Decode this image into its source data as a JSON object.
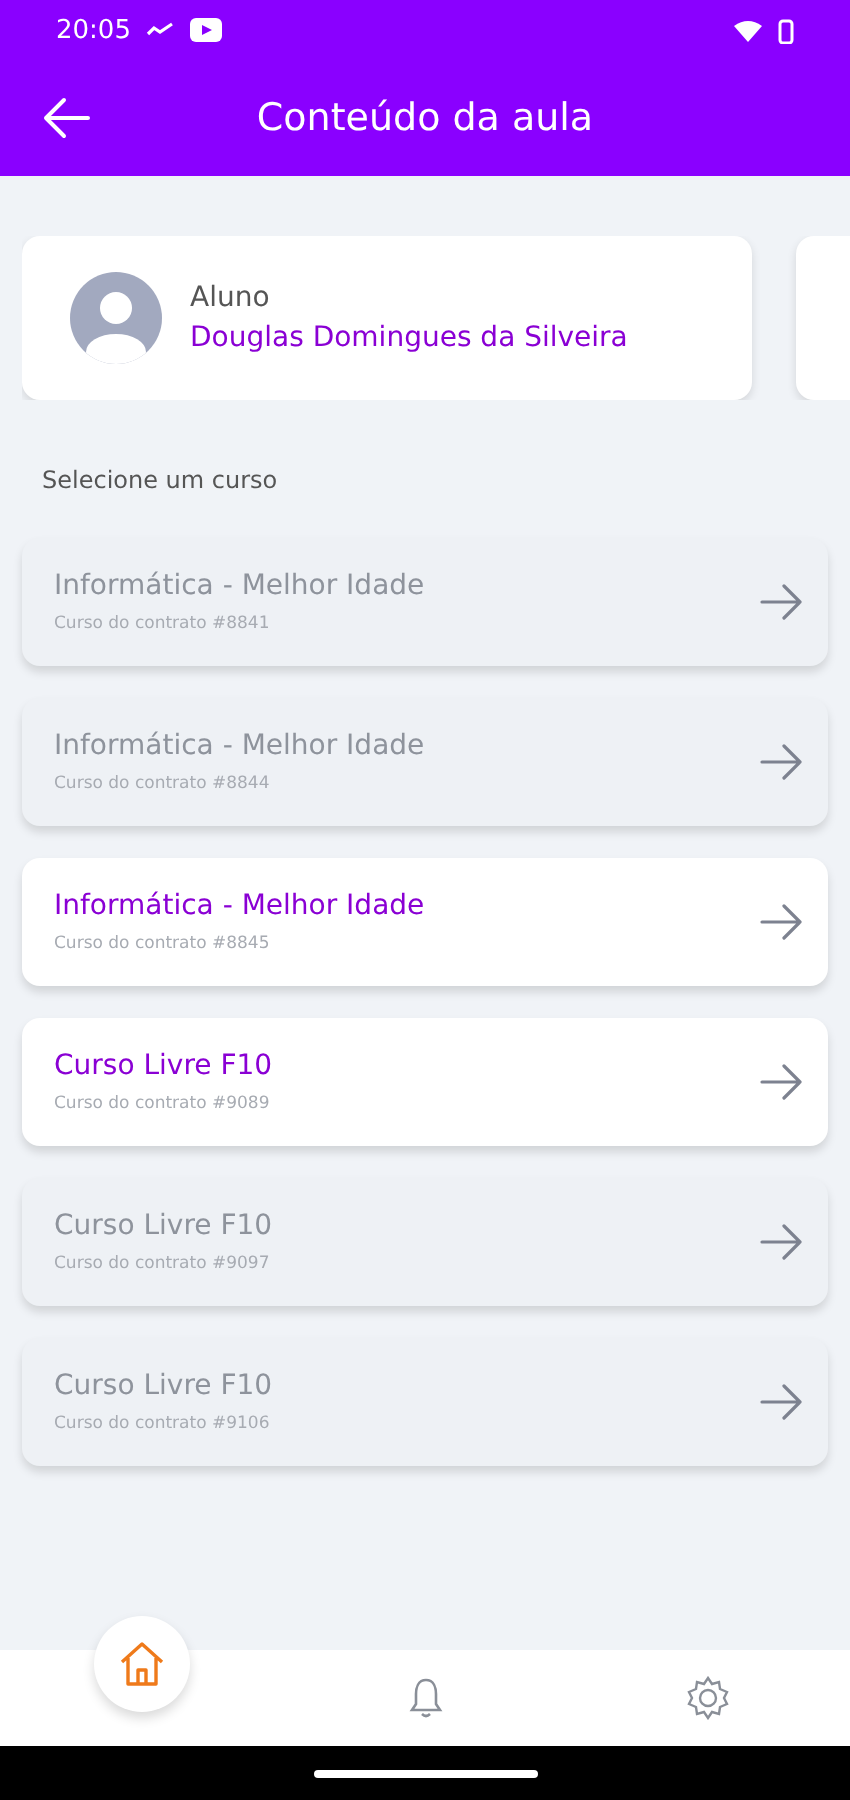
{
  "status_bar": {
    "time": "20:05"
  },
  "app_bar": {
    "title": "Conteúdo da aula"
  },
  "profile": {
    "role": "Aluno",
    "name": "Douglas Domingues da Silveira"
  },
  "section_label": "Selecione um curso",
  "courses": [
    {
      "title": "Informática - Melhor Idade",
      "subtitle": "Curso do contrato #8841",
      "selected": false
    },
    {
      "title": "Informática - Melhor Idade",
      "subtitle": "Curso do contrato #8844",
      "selected": false
    },
    {
      "title": "Informática - Melhor Idade",
      "subtitle": "Curso do contrato #8845",
      "selected": true
    },
    {
      "title": "Curso Livre F10",
      "subtitle": "Curso do contrato #9089",
      "selected": true
    },
    {
      "title": "Curso Livre F10",
      "subtitle": "Curso do contrato #9097",
      "selected": false
    },
    {
      "title": "Curso Livre F10",
      "subtitle": "Curso do contrato #9106",
      "selected": false
    }
  ],
  "bottom_nav": [
    {
      "kind": "home",
      "selected": true
    },
    {
      "kind": "bell",
      "selected": false
    },
    {
      "kind": "settings",
      "selected": false
    }
  ]
}
